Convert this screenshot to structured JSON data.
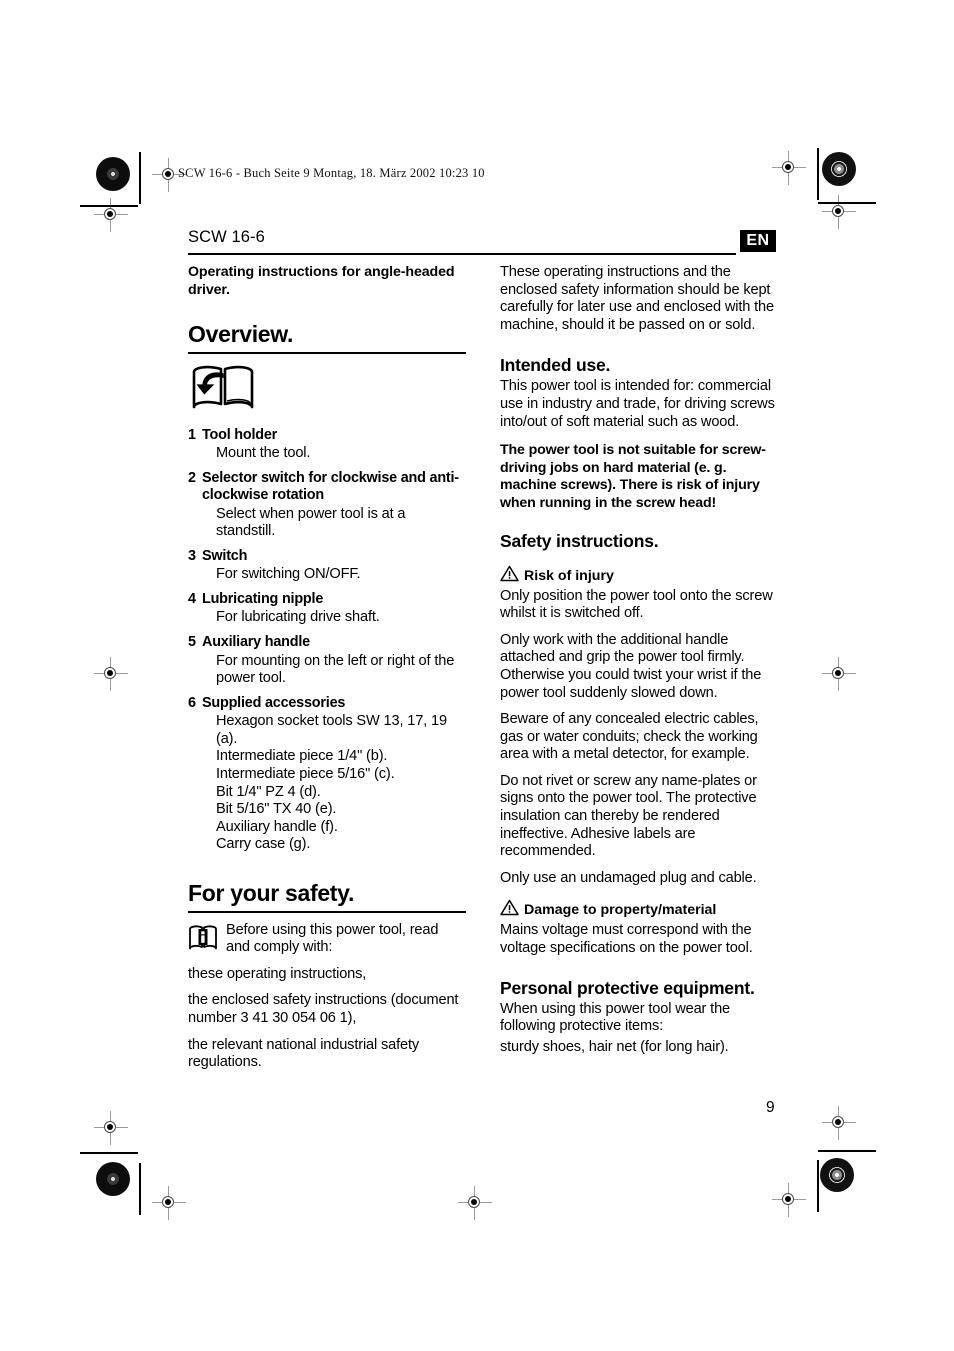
{
  "print_marks": {
    "slug_text": "SCW 16-6 - Buch  Seite 9  Montag, 18. März 2002  10:23 10"
  },
  "header": {
    "running_head": "SCW 16-6",
    "language_badge": "EN"
  },
  "footer": {
    "page_number": "9"
  },
  "left_column": {
    "intro_heading": "Operating instructions for angle-headed driver.",
    "overview": {
      "title": "Overview.",
      "icon": "open-book-with-arrow-icon",
      "items": [
        {
          "num": "1",
          "title": "Tool holder",
          "desc": [
            "Mount the tool."
          ]
        },
        {
          "num": "2",
          "title": "Selector switch for clockwise and anti-clockwise rotation",
          "desc": [
            "Select when power tool is at a standstill."
          ]
        },
        {
          "num": "3",
          "title": "Switch",
          "desc": [
            "For switching ON/OFF."
          ]
        },
        {
          "num": "4",
          "title": "Lubricating nipple",
          "desc": [
            "For lubricating drive shaft."
          ]
        },
        {
          "num": "5",
          "title": "Auxiliary handle",
          "desc": [
            "For mounting on the left or right of the power tool."
          ]
        },
        {
          "num": "6",
          "title": "Supplied accessories",
          "desc": [
            "Hexagon socket tools SW 13, 17, 19 (a).",
            "Intermediate piece 1/4\" (b).",
            "Intermediate piece 5/16\" (c).",
            "Bit 1/4\" PZ 4 (d).",
            "Bit 5/16\" TX 40 (e).",
            "Auxiliary handle (f).",
            "Carry case (g)."
          ]
        }
      ]
    },
    "safety": {
      "title": "For your safety.",
      "icon": "book-info-icon",
      "icon_paragraph": "Before using this power tool, read and comply with:",
      "lines": [
        "these operating instructions,",
        "the enclosed safety instructions (document number 3 41 30 054 06 1),",
        "the relevant national industrial safety regulations."
      ]
    }
  },
  "right_column": {
    "keep_instructions": "These operating instructions and the enclosed safety information should be kept carefully for later use and enclosed with the machine, should it be passed on or sold.",
    "intended_use": {
      "title": "Intended use.",
      "body": "This power tool is intended for: commercial use in industry and trade, for driving screws into/out of soft material such as wood.",
      "warning_bold": "The power tool is not suitable for screw-driving jobs on hard material (e. g. machine screws). There is risk of injury when running in the screw head!"
    },
    "safety_instructions": {
      "title": "Safety instructions.",
      "risk_heading": "Risk of injury",
      "risk_icon": "warning-triangle-icon",
      "risk_paragraphs": [
        "Only position the power tool onto the screw whilst it is switched off.",
        "Only work with the additional handle attached and grip the power tool firmly. Otherwise you could twist your wrist if the power tool suddenly slowed down.",
        "Beware of any concealed electric cables, gas or water conduits; check the working area with a metal detector, for example.",
        "Do not rivet or screw any name-plates or signs onto the power tool. The protective insulation can thereby be rendered ineffective. Adhesive labels are recommended.",
        "Only use an undamaged plug and cable."
      ],
      "damage_heading": "Damage to property/material",
      "damage_icon": "warning-triangle-icon",
      "damage_paragraph": "Mains voltage must correspond with the voltage specifications on the power tool."
    },
    "ppe": {
      "title": "Personal protective equipment.",
      "body": "When using this power tool wear the following protective items:",
      "items_line": "sturdy shoes, hair net (for long hair)."
    }
  }
}
